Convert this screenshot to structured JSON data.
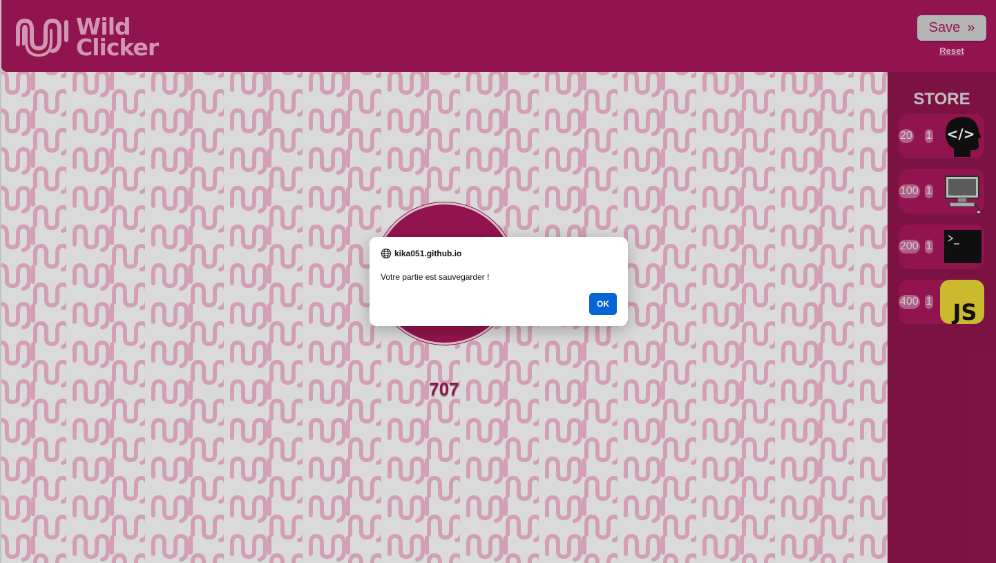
{
  "header": {
    "logo_line1": "Wild",
    "logo_line2": "Clicker",
    "save_label": "Save",
    "save_chevron": "»",
    "reset_label": "Reset"
  },
  "game": {
    "score": "707"
  },
  "store": {
    "title": "STORE",
    "items": [
      {
        "price": "20",
        "qty": "1",
        "icon": "developer-head-icon"
      },
      {
        "price": "100",
        "qty": "1",
        "icon": "computer-icon"
      },
      {
        "price": "200",
        "qty": "1",
        "icon": "terminal-icon"
      },
      {
        "price": "400",
        "qty": "1",
        "icon": "javascript-icon"
      }
    ]
  },
  "dialog": {
    "origin": "kika051.github.io",
    "message": "Votre partie est sauvegarder !",
    "ok_label": "OK"
  },
  "colors": {
    "brand": "#a31757",
    "store_bg": "#8b1549",
    "pattern": "#e8b3c9",
    "ok_blue": "#0764d6"
  }
}
